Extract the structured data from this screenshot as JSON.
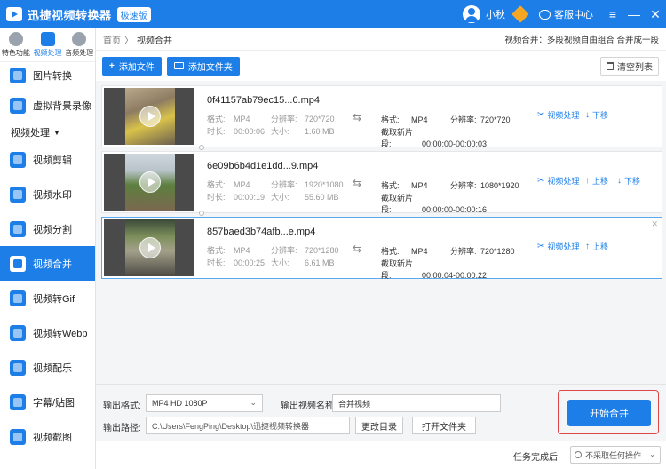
{
  "titlebar": {
    "app_title": "迅捷视频转换器",
    "badge": "极速版",
    "username": "小秋",
    "service_label": "客服中心",
    "buttons": {
      "menu": "≡",
      "minimize": "—",
      "close": "✕"
    }
  },
  "sidebar": {
    "tabs": [
      {
        "label": "特色功能"
      },
      {
        "label": "视频处理"
      },
      {
        "label": "音频处理"
      }
    ],
    "items_top": [
      {
        "label": "图片转换"
      },
      {
        "label": "虚拟背景录像"
      }
    ],
    "section_label": "视频处理",
    "section_caret": "▼",
    "items": [
      {
        "label": "视频剪辑"
      },
      {
        "label": "视频水印"
      },
      {
        "label": "视频分割"
      },
      {
        "label": "视频合并"
      },
      {
        "label": "视频转Gif"
      },
      {
        "label": "视频转Webp"
      },
      {
        "label": "视频配乐"
      },
      {
        "label": "字幕/贴图"
      },
      {
        "label": "视频截图"
      }
    ]
  },
  "breadcrumb": {
    "home": "首页",
    "sep": "〉",
    "current": "视频合并",
    "merge_mode": "视频合并：多段视频自由组合 合并成一段"
  },
  "toolbar": {
    "add_file": "添加文件",
    "add_folder": "添加文件夹",
    "clear_list": "清空列表",
    "plus": "+"
  },
  "labels": {
    "format": "格式:",
    "duration": "时长:",
    "resolution": "分辨率:",
    "size": "大小:",
    "clip": "截取新片段:",
    "process": "视频处理",
    "up": "上移",
    "down": "下移",
    "arrows": "⇆",
    "scissors": "✂",
    "up_arrow": "↑",
    "down_arrow": "↓",
    "close": "✕"
  },
  "files": [
    {
      "name": "0f41157ab79ec15...0.mp4",
      "format": "MP4",
      "resolution": "720*720",
      "duration": "00:00:06",
      "size": "1.60 MB",
      "out_format": "MP4",
      "out_resolution": "720*720",
      "clip": "00:00:00-00:00:03",
      "show_up": false,
      "show_down": true
    },
    {
      "name": "6e09b6b4d1e1dd...9.mp4",
      "format": "MP4",
      "resolution": "1920*1080",
      "duration": "00:00:19",
      "size": "55.60 MB",
      "out_format": "MP4",
      "out_resolution": "1080*1920",
      "clip": "00:00:00-00:00:16",
      "show_up": true,
      "show_down": true
    },
    {
      "name": "857baed3b74afb...e.mp4",
      "format": "MP4",
      "resolution": "720*1280",
      "duration": "00:00:25",
      "size": "6.61 MB",
      "out_format": "MP4",
      "out_resolution": "720*1280",
      "clip": "00:00:04-00:00:22",
      "show_up": true,
      "show_down": false
    }
  ],
  "bottom": {
    "output_format_label": "输出格式:",
    "output_format_value": "MP4  HD 1080P",
    "output_name_label": "输出视频名称",
    "output_name_value": "合并视频",
    "output_path_label": "输出路径:",
    "output_path_value": "C:\\Users\\FengPing\\Desktop\\迅捷视频转换器",
    "change_dir": "更改目录",
    "open_folder": "打开文件夹",
    "start_merge": "开始合并",
    "chevron": "⌄"
  },
  "status": {
    "label": "任务完成后",
    "select_value": "不采取任何操作",
    "chevron": "⌄"
  }
}
